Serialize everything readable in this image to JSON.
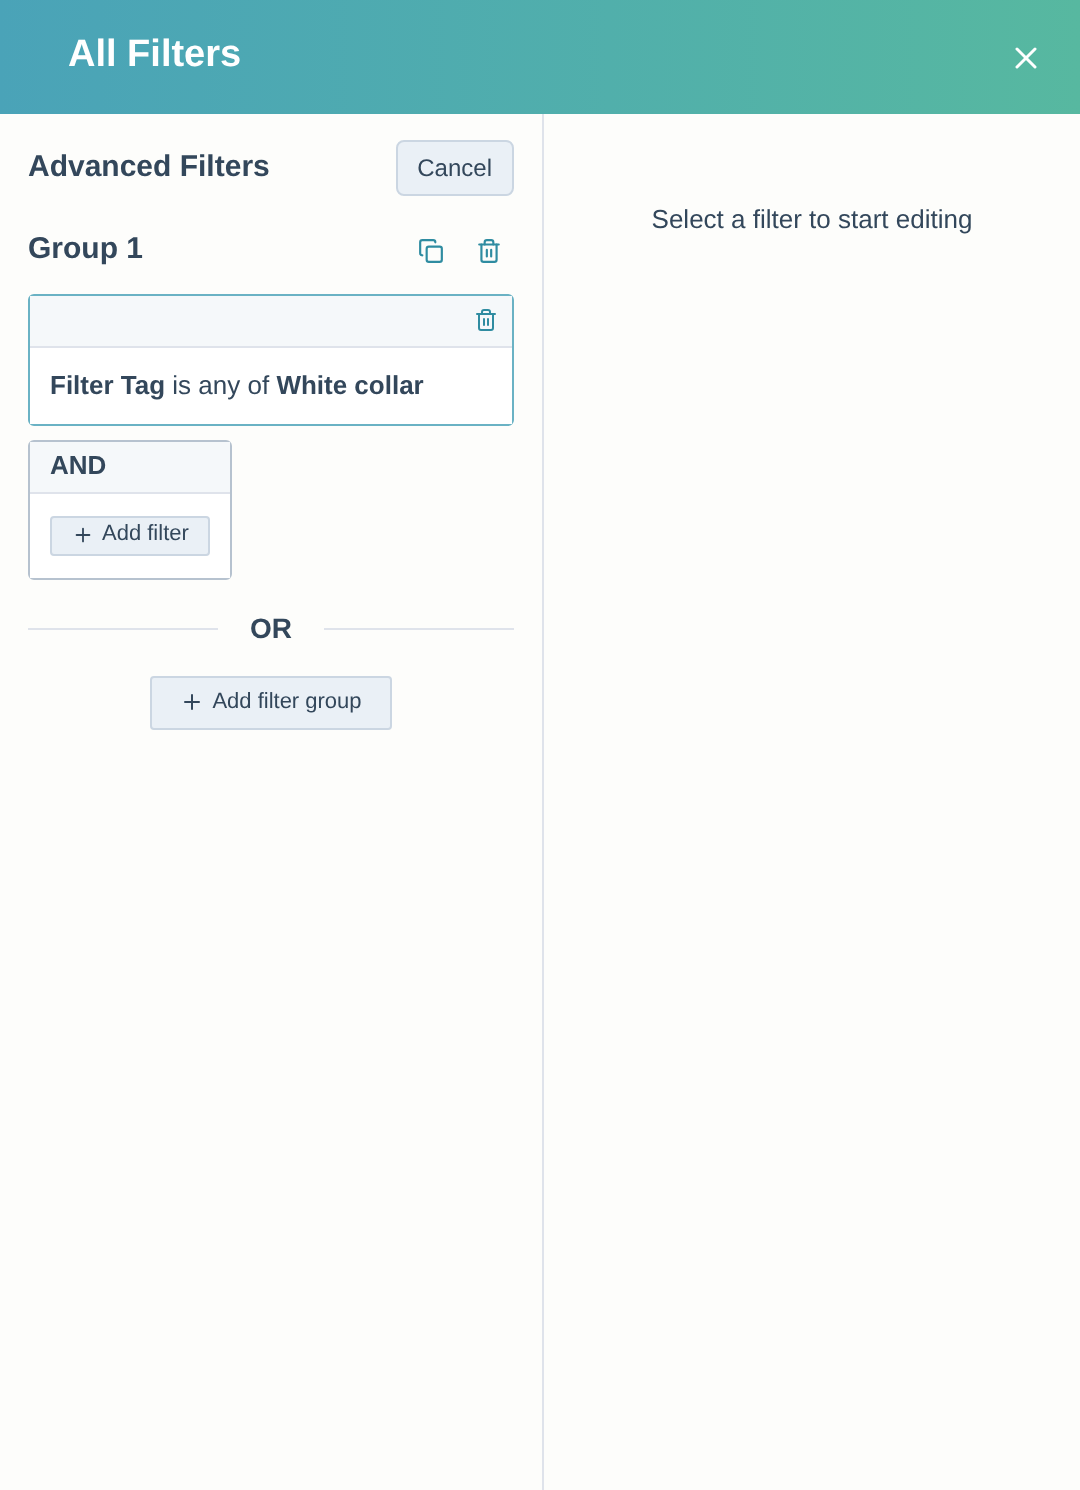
{
  "header": {
    "title": "All Filters"
  },
  "left_panel": {
    "title": "Advanced Filters",
    "cancel_button": "Cancel",
    "group": {
      "title": "Group 1",
      "filters": [
        {
          "text": "**Filter Tag** is any of **White collar**",
          "selected": true
        }
      ],
      "and_block": {
        "label": "AND",
        "add_filter_button": "Add filter"
      }
    },
    "or_divider": "OR",
    "add_group_button": "Add filter group"
  },
  "right_panel": {
    "message": "Select a filter to start editing"
  }
}
